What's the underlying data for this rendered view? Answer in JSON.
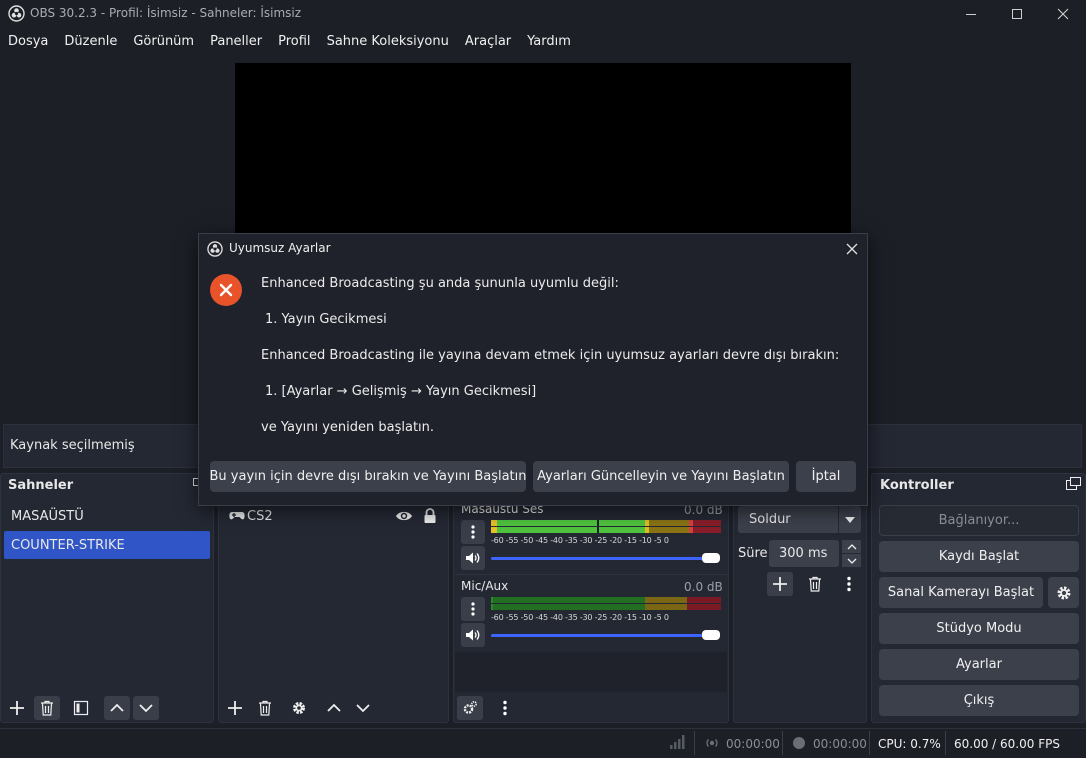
{
  "window": {
    "title": "OBS 30.2.3 - Profil: İsimsiz - Sahneler: İsimsiz"
  },
  "menu": [
    "Dosya",
    "Düzenle",
    "Görünüm",
    "Paneller",
    "Profil",
    "Sahne Koleksiyonu",
    "Araçlar",
    "Yardım"
  ],
  "source_bar": {
    "text": "Kaynak seçilmemiş"
  },
  "scenes": {
    "title": "Sahneler",
    "items": [
      "MASAÜSTÜ",
      "COUNTER-STRIKE"
    ],
    "selected_index": 1
  },
  "sources": {
    "items": [
      {
        "name": "CS2",
        "icon": "gamepad-icon",
        "visible": true,
        "locked": true
      }
    ]
  },
  "mixer": {
    "ticks": "-60 -55 -50 -45 -40 -35 -30 -25 -20 -15 -10 -5 0",
    "channels": [
      {
        "name": "Masaüstü Ses",
        "db": "0.0 dB",
        "volume": 1.0
      },
      {
        "name": "Mic/Aux",
        "db": "0.0 dB",
        "volume": 1.0
      }
    ]
  },
  "transitions": {
    "type": "Soldur",
    "duration_label": "Süre",
    "duration_value": "300 ms"
  },
  "controls": {
    "title": "Kontroller",
    "buttons": [
      "Bağlanıyor...",
      "Kaydı Başlat",
      "Sanal Kamerayı Başlat",
      "Stüdyo Modu",
      "Ayarlar",
      "Çıkış"
    ]
  },
  "status": {
    "stream_time": "00:00:00",
    "record_time": "00:00:00",
    "cpu": "CPU: 0.7%",
    "fps": "60.00 / 60.00 FPS"
  },
  "dialog": {
    "title": "Uyumsuz Ayarlar",
    "lines": [
      "Enhanced Broadcasting şu anda şununla uyumlu değil:",
      "1. Yayın Gecikmesi",
      "Enhanced Broadcasting ile yayına devam etmek için uyumsuz ayarları devre dışı bırakın:",
      "1. [Ayarlar → Gelişmiş → Yayın Gecikmesi]",
      "ve Yayını yeniden başlatın."
    ],
    "buttons": {
      "disable": "Bu yayın için devre dışı bırakın ve Yayını Başlatın",
      "update": "Ayarları Güncelleyin ve Yayını Başlatın",
      "cancel": "İptal"
    }
  },
  "colors": {
    "accent": "#2f55c7",
    "error": "#e8532a",
    "bg": "#1c1f26",
    "panel": "#242833",
    "button": "#3c404b"
  }
}
